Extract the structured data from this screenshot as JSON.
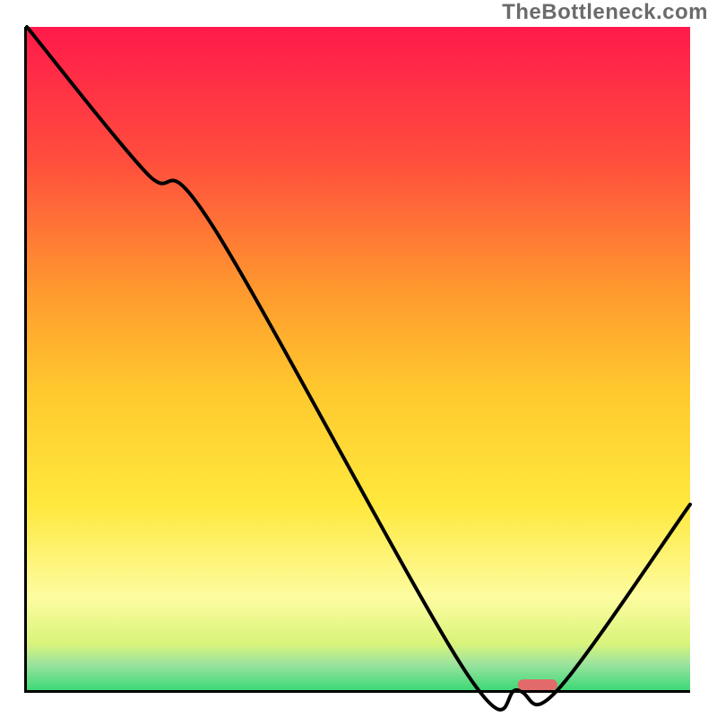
{
  "watermark": "TheBottleneck.com",
  "chart_data": {
    "type": "line",
    "xlim": [
      0,
      100
    ],
    "ylim": [
      0,
      100
    ],
    "title": "",
    "xlabel": "",
    "ylabel": "",
    "gradient_stops": [
      {
        "pct": 0,
        "color": "#ff1a4b"
      },
      {
        "pct": 20,
        "color": "#ff4d3d"
      },
      {
        "pct": 40,
        "color": "#ff9a2e"
      },
      {
        "pct": 55,
        "color": "#ffc92e"
      },
      {
        "pct": 72,
        "color": "#ffe83d"
      },
      {
        "pct": 86,
        "color": "#fdfca0"
      },
      {
        "pct": 93,
        "color": "#d9f47a"
      },
      {
        "pct": 96,
        "color": "#9de39e"
      },
      {
        "pct": 100,
        "color": "#3dd977"
      }
    ],
    "series": [
      {
        "name": "bottleneck-curve",
        "x": [
          0,
          18,
          28,
          66,
          74,
          80,
          100
        ],
        "y": [
          100,
          78,
          70,
          3,
          0,
          0,
          28
        ]
      }
    ],
    "marker": {
      "x_start": 74,
      "x_end": 80,
      "y": 0
    }
  }
}
